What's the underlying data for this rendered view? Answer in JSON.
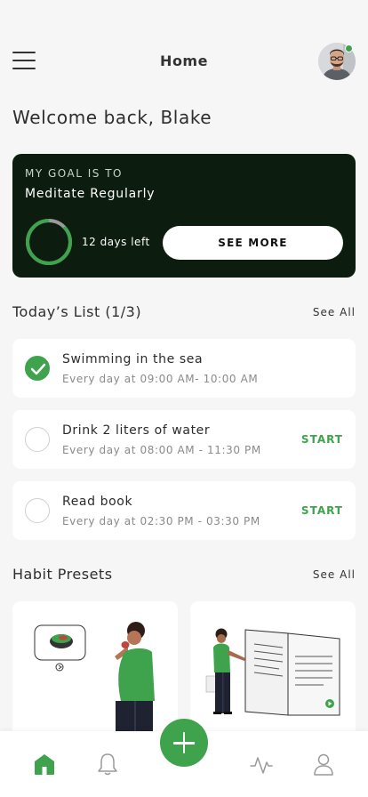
{
  "header": {
    "title": "Home",
    "menu_icon": "hamburger-menu-icon",
    "avatar_status": "online"
  },
  "welcome": "Welcome back, Blake",
  "goal": {
    "kicker": "MY GOAL IS TO",
    "name": "Meditate Regularly",
    "days_left": "12 days left",
    "progress": 0.85,
    "button_label": "SEE MORE"
  },
  "todays_list": {
    "title": "Today’s List (1/3)",
    "see_all": "See All",
    "items": [
      {
        "title": "Swimming in the sea",
        "time": "Every day at 09:00 AM- 10:00 AM",
        "done": true,
        "action": ""
      },
      {
        "title": "Drink 2 liters of water",
        "time": "Every day at 08:00 AM - 11:30 PM",
        "done": false,
        "action": "START"
      },
      {
        "title": "Read book",
        "time": "Every day at 02:30 PM - 03:30 PM",
        "done": false,
        "action": "START"
      }
    ]
  },
  "habit_presets": {
    "title": "Habit Presets",
    "see_all": "See All"
  },
  "nav": {
    "items": [
      "home-icon",
      "bell-icon",
      "activity-icon",
      "profile-icon"
    ],
    "fab": "plus-icon"
  },
  "colors": {
    "accent": "#3fa34d",
    "goal_card_bg": "#0c1c0e",
    "background": "#f6f6f6"
  }
}
